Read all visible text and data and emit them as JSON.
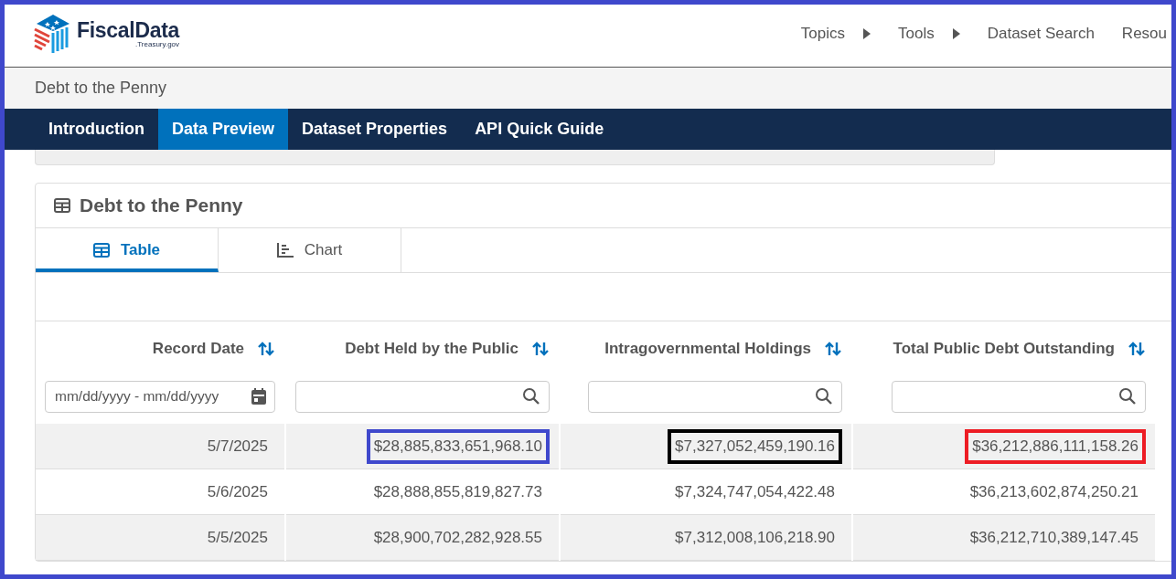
{
  "header": {
    "logo_name": "FiscalData",
    "logo_domain": ".Treasury.gov",
    "nav": [
      {
        "label": "Topics",
        "has_menu": true
      },
      {
        "label": "Tools",
        "has_menu": true
      },
      {
        "label": "Dataset Search",
        "has_menu": false
      },
      {
        "label": "Resou",
        "has_menu": false
      }
    ]
  },
  "breadcrumb": "Debt to the Penny",
  "section_tabs": [
    {
      "label": "Introduction",
      "selected": false
    },
    {
      "label": "Data Preview",
      "selected": true
    },
    {
      "label": "Dataset Properties",
      "selected": false
    },
    {
      "label": "API Quick Guide",
      "selected": false
    }
  ],
  "card": {
    "title": "Debt to the Penny",
    "view_tabs": [
      {
        "label": "Table",
        "kind": "table",
        "selected": true
      },
      {
        "label": "Chart",
        "kind": "chart",
        "selected": false
      }
    ],
    "table": {
      "columns": [
        {
          "label": "Record Date",
          "kind": "date",
          "placeholder": "mm/dd/yyyy - mm/dd/yyyy"
        },
        {
          "label": "Debt Held by the Public",
          "kind": "search"
        },
        {
          "label": "Intragovernmental Holdings",
          "kind": "search"
        },
        {
          "label": "Total Public Debt Outstanding",
          "kind": "search"
        }
      ],
      "rows": [
        {
          "cells": [
            {
              "text": "5/7/2025"
            },
            {
              "text": "$28,885,833,651,968.10",
              "color": "#3f48cc"
            },
            {
              "text": "$7,327,052,459,190.16",
              "color": "#000000"
            },
            {
              "text": "$36,212,886,111,158.26",
              "color": "#ed1c24"
            }
          ]
        },
        {
          "cells": [
            {
              "text": "5/6/2025"
            },
            {
              "text": "$28,888,855,819,827.73"
            },
            {
              "text": "$7,324,747,054,422.48"
            },
            {
              "text": "$36,213,602,874,250.21"
            }
          ]
        },
        {
          "cells": [
            {
              "text": "5/5/2025"
            },
            {
              "text": "$28,900,702,282,928.55"
            },
            {
              "text": "$7,312,008,106,218.90"
            },
            {
              "text": "$36,212,710,389,147.45"
            }
          ]
        }
      ]
    }
  }
}
